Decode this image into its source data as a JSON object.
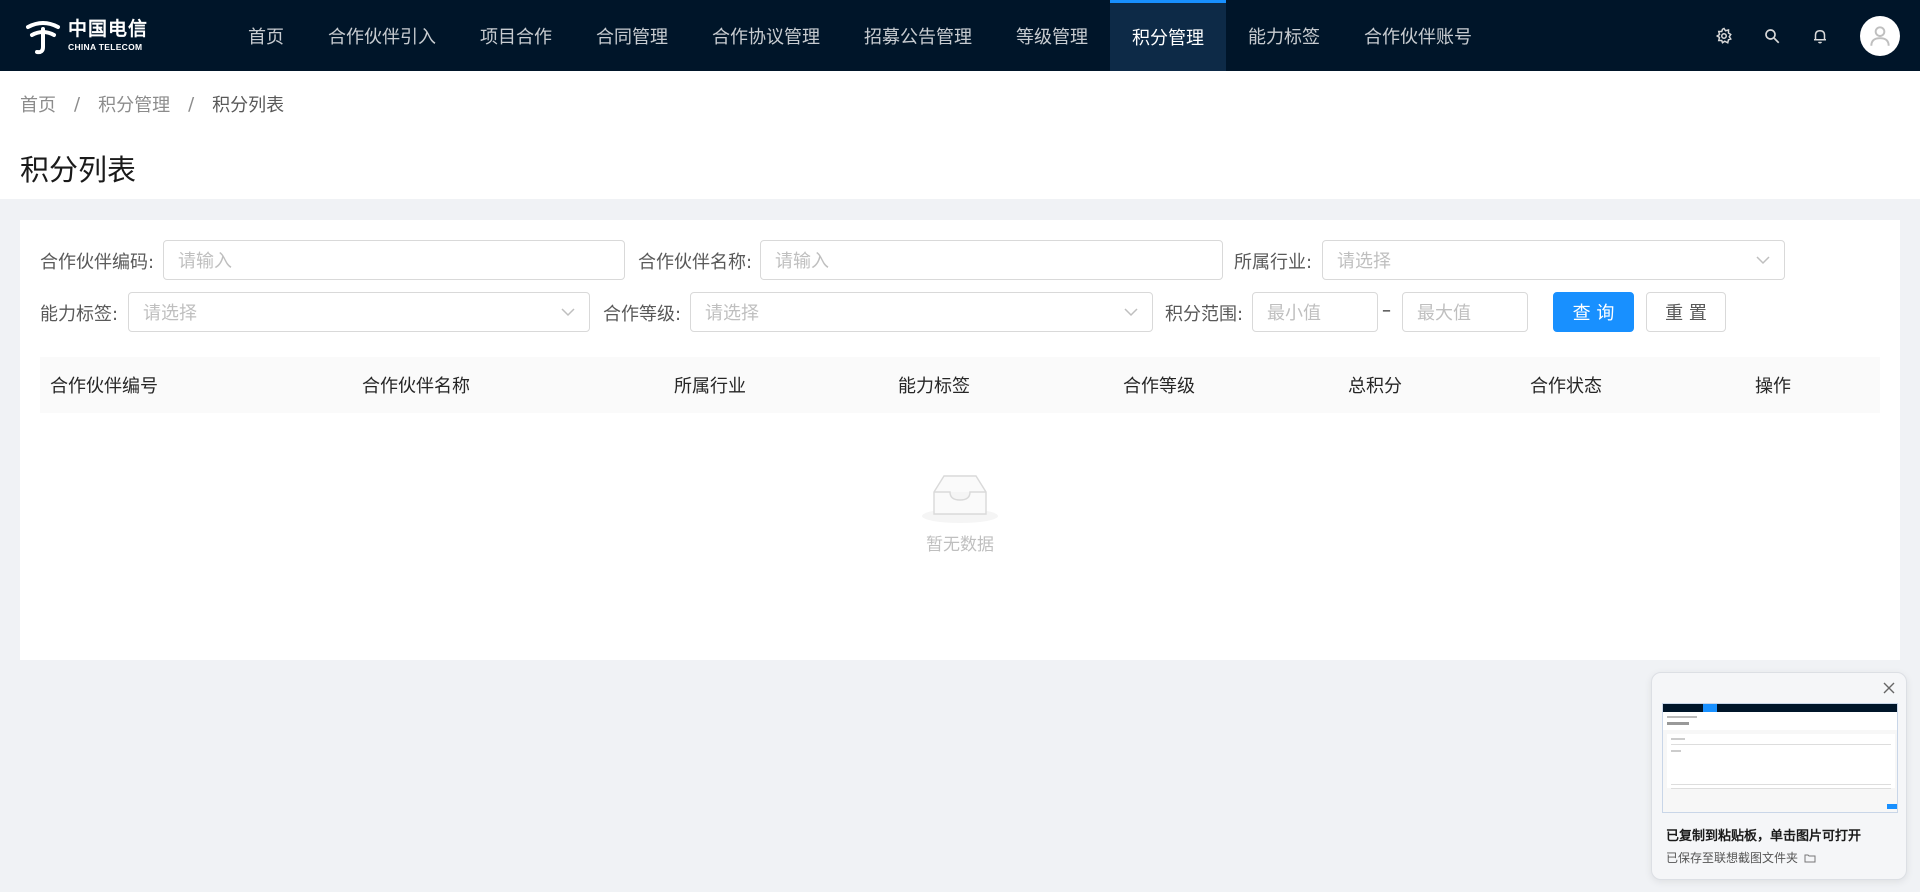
{
  "brand": {
    "name_cn": "中国电信",
    "name_en": "CHINA TELECOM"
  },
  "nav": {
    "items": [
      {
        "label": "首页"
      },
      {
        "label": "合作伙伴引入"
      },
      {
        "label": "项目合作"
      },
      {
        "label": "合同管理"
      },
      {
        "label": "合作协议管理"
      },
      {
        "label": "招募公告管理"
      },
      {
        "label": "等级管理"
      },
      {
        "label": "积分管理",
        "active": true
      },
      {
        "label": "能力标签"
      },
      {
        "label": "合作伙伴账号"
      }
    ],
    "icons": [
      "gear-icon",
      "search-icon",
      "bell-icon",
      "user-avatar"
    ]
  },
  "breadcrumb": {
    "home": "首页",
    "sep": "/",
    "parent": "积分管理",
    "current": "积分列表"
  },
  "page": {
    "title": "积分列表"
  },
  "filters": {
    "partner_code_label": "合作伙伴编码:",
    "partner_code_placeholder": "请输入",
    "partner_name_label": "合作伙伴名称:",
    "partner_name_placeholder": "请输入",
    "industry_label": "所属行业:",
    "industry_placeholder": "请选择",
    "ability_label": "能力标签:",
    "ability_placeholder": "请选择",
    "level_label": "合作等级:",
    "level_placeholder": "请选择",
    "score_range_label": "积分范围:",
    "score_min_placeholder": "最小值",
    "score_max_placeholder": "最大值",
    "range_dash": "–",
    "search_button": "查 询",
    "reset_button": "重 置"
  },
  "table": {
    "columns": [
      "合作伙伴编号",
      "合作伙伴名称",
      "所属行业",
      "能力标签",
      "合作等级",
      "总积分",
      "合作状态",
      "操作"
    ],
    "rows": [],
    "empty_text": "暂无数据"
  },
  "toast": {
    "title": "已复制到粘贴板，单击图片可打开",
    "subtitle": "已保存至联想截图文件夹"
  },
  "colors": {
    "nav_bg": "#001529",
    "accent": "#1890ff",
    "page_bg": "#f0f2f5"
  }
}
